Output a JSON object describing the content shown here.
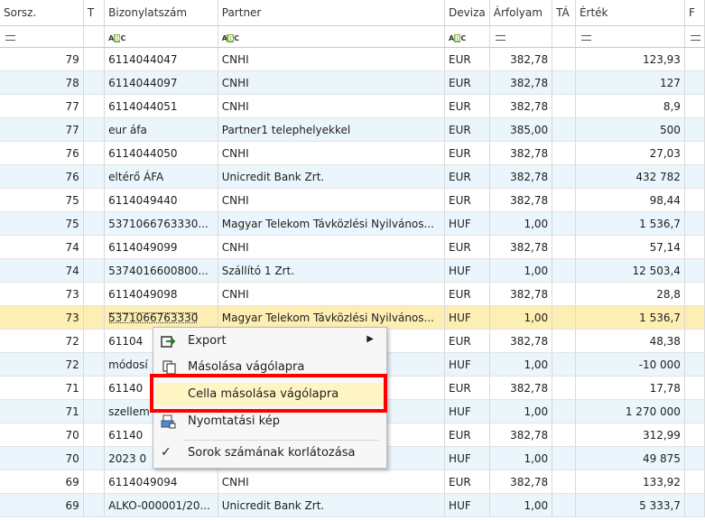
{
  "columns": [
    "Sorsz.",
    "T",
    "Bizonylatszám",
    "Partner",
    "Deviza",
    "Árfolyam",
    "TÁ",
    "Érték",
    "F"
  ],
  "filter_text_icon": "ABC",
  "rows": [
    {
      "sorsz": "79",
      "biz": "6114044047",
      "partner": "CNHI",
      "deviza": "EUR",
      "arf": "382,78",
      "ertek": "123,93"
    },
    {
      "sorsz": "78",
      "biz": "6114044097",
      "partner": "CNHI",
      "deviza": "EUR",
      "arf": "382,78",
      "ertek": "127"
    },
    {
      "sorsz": "77",
      "biz": "6114044051",
      "partner": "CNHI",
      "deviza": "EUR",
      "arf": "382,78",
      "ertek": "8,9"
    },
    {
      "sorsz": "77",
      "biz": "eur áfa",
      "partner": "Partner1 telephelyekkel",
      "deviza": "EUR",
      "arf": "385,00",
      "ertek": "500"
    },
    {
      "sorsz": "76",
      "biz": "6114044050",
      "partner": "CNHI",
      "deviza": "EUR",
      "arf": "382,78",
      "ertek": "27,03"
    },
    {
      "sorsz": "76",
      "biz": "eltérő ÁFA",
      "partner": "Unicredit Bank Zrt.",
      "deviza": "EUR",
      "arf": "382,78",
      "ertek": "432 782"
    },
    {
      "sorsz": "75",
      "biz": "6114049440",
      "partner": "CNHI",
      "deviza": "EUR",
      "arf": "382,78",
      "ertek": "98,44"
    },
    {
      "sorsz": "75",
      "biz": "5371066763330...",
      "partner": "Magyar Telekom Távközlési Nyilvános...",
      "deviza": "HUF",
      "arf": "1,00",
      "ertek": "1 536,7"
    },
    {
      "sorsz": "74",
      "biz": "6114049099",
      "partner": "CNHI",
      "deviza": "EUR",
      "arf": "382,78",
      "ertek": "57,14"
    },
    {
      "sorsz": "74",
      "biz": "5374016600800...",
      "partner": "Szállító 1 Zrt.",
      "deviza": "HUF",
      "arf": "1,00",
      "ertek": "12 503,4"
    },
    {
      "sorsz": "73",
      "biz": "6114049098",
      "partner": "CNHI",
      "deviza": "EUR",
      "arf": "382,78",
      "ertek": "28,8"
    },
    {
      "sorsz": "73",
      "biz": "5371066763330",
      "partner": "Magyar Telekom Távközlési Nyilvános...",
      "deviza": "HUF",
      "arf": "1,00",
      "ertek": "1 536,7"
    },
    {
      "sorsz": "72",
      "biz": "61104",
      "partner": "",
      "deviza": "EUR",
      "arf": "382,78",
      "ertek": "48,38"
    },
    {
      "sorsz": "72",
      "biz": "módosí",
      "partner": "",
      "deviza": "HUF",
      "arf": "1,00",
      "ertek": "-10 000"
    },
    {
      "sorsz": "71",
      "biz": "61140",
      "partner": "",
      "deviza": "EUR",
      "arf": "382,78",
      "ertek": "17,78"
    },
    {
      "sorsz": "71",
      "biz": "szellem",
      "partner": "",
      "deviza": "HUF",
      "arf": "1,00",
      "ertek": "1 270 000"
    },
    {
      "sorsz": "70",
      "biz": "61140",
      "partner": "",
      "deviza": "EUR",
      "arf": "382,78",
      "ertek": "312,99"
    },
    {
      "sorsz": "70",
      "biz": "2023 0",
      "partner": "",
      "deviza": "HUF",
      "arf": "1,00",
      "ertek": "49 875"
    },
    {
      "sorsz": "69",
      "biz": "6114049094",
      "partner": "CNHI",
      "deviza": "EUR",
      "arf": "382,78",
      "ertek": "133,92"
    },
    {
      "sorsz": "69",
      "biz": "ALKO-000001/20...",
      "partner": "Unicredit Bank Zrt.",
      "deviza": "HUF",
      "arf": "1,00",
      "ertek": "5 333,7"
    }
  ],
  "context_menu": {
    "items": [
      {
        "label": "Export",
        "icon": "export-icon",
        "submenu": true
      },
      {
        "label": "Másolása vágólapra",
        "icon": "copy-icon"
      },
      {
        "label": "Cella másolása vágólapra",
        "icon": ""
      },
      {
        "label": "Nyomtatási kép",
        "icon": "print-preview-icon"
      },
      {
        "label": "Sorok számának korlátozása",
        "icon": "check-icon"
      }
    ],
    "highlight_color": "#ff0000"
  }
}
